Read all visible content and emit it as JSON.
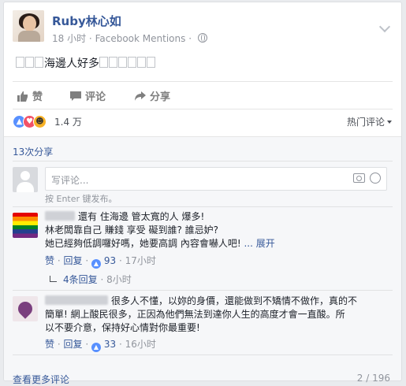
{
  "post": {
    "author": "Ruby林心如",
    "time": "18 小时",
    "separator": "·",
    "source": "Facebook Mentions",
    "separator2": "·",
    "text": "海邊人好多"
  },
  "actions": {
    "like": "赞",
    "comment": "评论",
    "share": "分享"
  },
  "reactions": {
    "count": "1.4 万",
    "sort_label": "热门评论"
  },
  "shares_label": "13次分享",
  "composer": {
    "placeholder": "写评论...",
    "hint": "按 Enter 键发布。"
  },
  "comments": [
    {
      "line1": "還有 住海邊 管太寬的人 爆多!",
      "line2": "林老闆靠自己 賺錢 享受 礙到誰? 誰忌妒?",
      "line3": "她已經夠低調囉好嗎，她要高調 內容會嚇人吧!",
      "more": "... 展开",
      "like": "赞",
      "reply": "回复",
      "likes": "93",
      "time": "17小时",
      "dot": "·",
      "replies": {
        "label": "4条回复",
        "time": "8小时"
      }
    },
    {
      "line1": "很多人不懂，以妳的身價，還能做到不矯情不做作，真的不",
      "line2": "簡單! 網上酸民很多，正因為他們無法到達你人生的高度才會一直酸。所",
      "line3": "以不要介意，保持好心情對你最重要!",
      "like": "赞",
      "reply": "回复",
      "likes": "33",
      "time": "16小时",
      "dot": "·"
    }
  ],
  "footer": {
    "see_more": "查看更多评论",
    "pager": "2 / 196"
  },
  "colors": {
    "link": "#365899",
    "like_blue": "#5890ff",
    "love_red": "#f25268",
    "haha_yellow": "#f7b125"
  }
}
